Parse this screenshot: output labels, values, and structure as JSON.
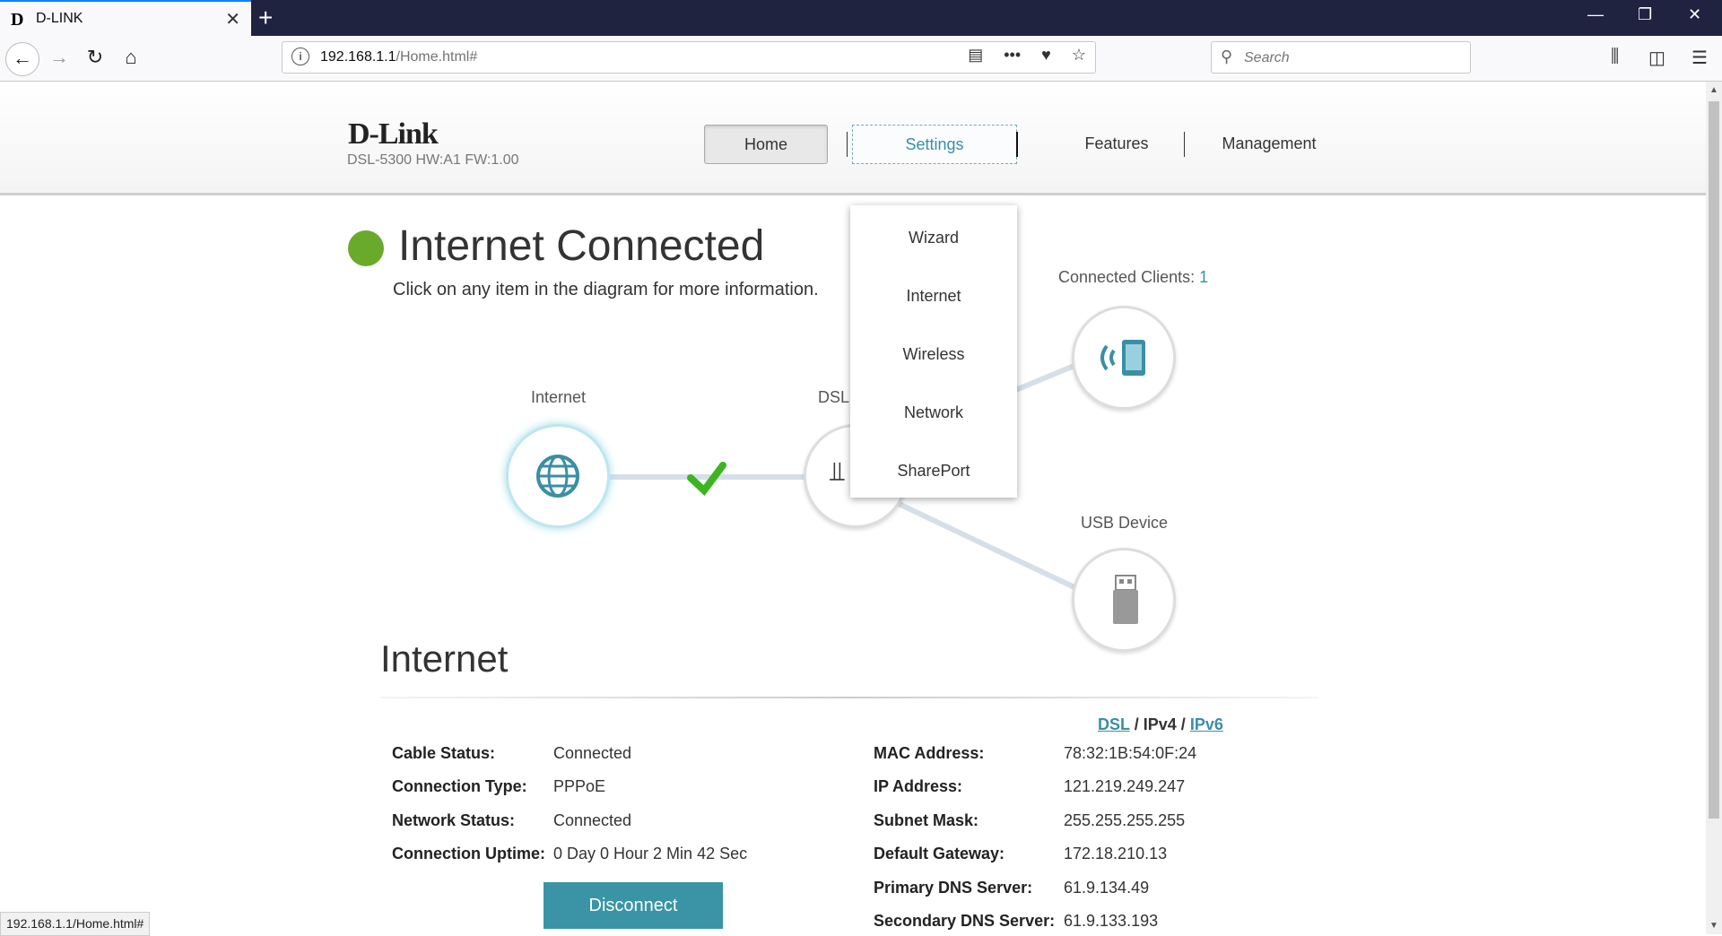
{
  "browser": {
    "tab_title": "D-LINK",
    "tab_favicon": "D",
    "url_host": "192.168.1.1",
    "url_path": "/Home.html#",
    "search_placeholder": "Search",
    "status_url": "192.168.1.1/Home.html#"
  },
  "router": {
    "logo": "D-Link",
    "model": "DSL-5300 HW:A1 FW:1.00"
  },
  "menu": {
    "home": "Home",
    "settings": "Settings",
    "features": "Features",
    "management": "Management"
  },
  "settings_dropdown": [
    "Wizard",
    "Internet",
    "Wireless",
    "Network",
    "SharePort"
  ],
  "status": {
    "title": "Internet Connected",
    "subtitle": "Click on any item in the diagram for more information.",
    "color": "#6aaa2a"
  },
  "diagram": {
    "internet_label": "Internet",
    "dsl_label": "DSL",
    "clients_label": "Connected Clients:",
    "clients_count": "1",
    "usb_label": "USB Device"
  },
  "section": {
    "title": "Internet",
    "link_dsl": "DSL",
    "link_ipv4": "IPv4",
    "link_ipv6": "IPv6",
    "separator": "/"
  },
  "left_info": [
    {
      "label": "Cable Status:",
      "value": "Connected"
    },
    {
      "label": "Connection Type:",
      "value": "PPPoE"
    },
    {
      "label": "Network Status:",
      "value": "Connected"
    },
    {
      "label": "Connection Uptime:",
      "value": "0 Day 0 Hour 2 Min 42 Sec"
    }
  ],
  "right_info": [
    {
      "label": "MAC Address:",
      "value": "78:32:1B:54:0F:24"
    },
    {
      "label": "IP Address:",
      "value": "121.219.249.247"
    },
    {
      "label": "Subnet Mask:",
      "value": "255.255.255.255"
    },
    {
      "label": "Default Gateway:",
      "value": "172.18.210.13"
    },
    {
      "label": "Primary DNS Server:",
      "value": "61.9.134.49"
    },
    {
      "label": "Secondary DNS Server:",
      "value": "61.9.133.193"
    }
  ],
  "disconnect_label": "Disconnect",
  "accent_color": "#3a8fa5"
}
